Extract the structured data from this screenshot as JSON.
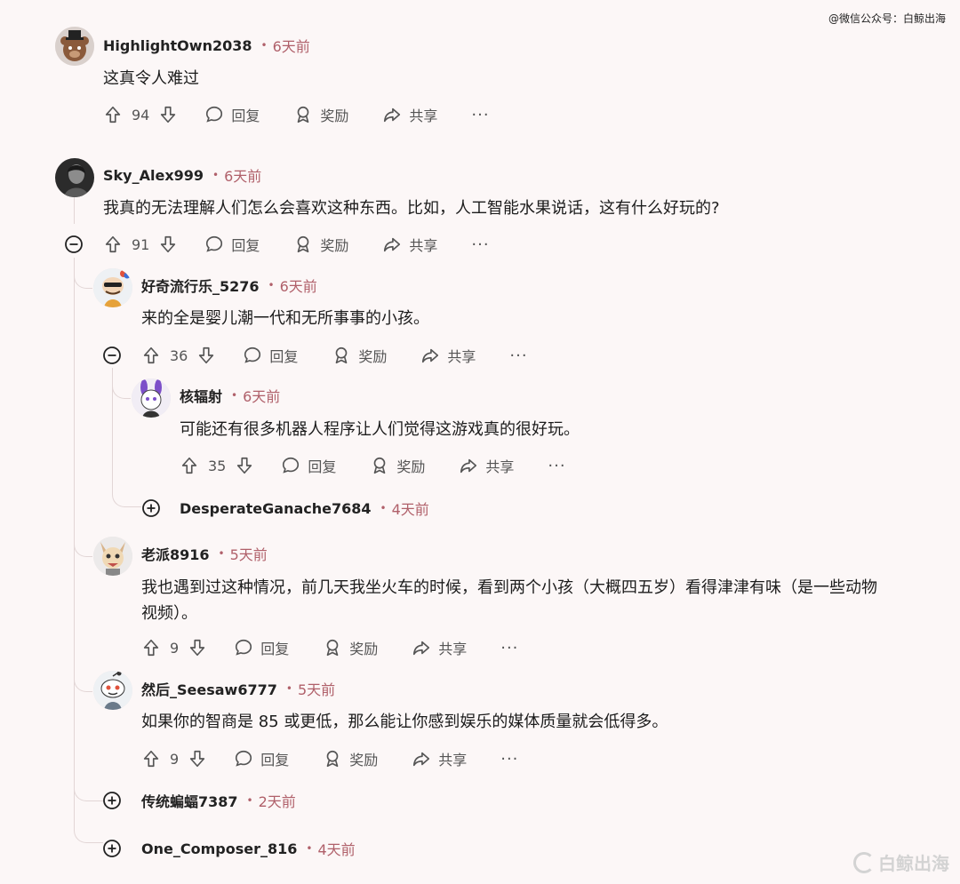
{
  "watermark": {
    "top": "@微信公众号：白鲸出海",
    "bottom": "白鲸出海"
  },
  "actions": {
    "reply": "回复",
    "award": "奖励",
    "share": "共享",
    "more": "···"
  },
  "comments": [
    {
      "username": "HighlightOwn2038",
      "dot": "•",
      "time": "6天前",
      "text": "这真令人难过",
      "votes": "94"
    },
    {
      "username": "Sky_Alex999",
      "dot": "•",
      "time": "6天前",
      "text": "我真的无法理解人们怎么会喜欢这种东西。比如，人工智能水果说话，这有什么好玩的?",
      "votes": "91"
    },
    {
      "username": "好奇流行乐_5276",
      "dot": "•",
      "time": "6天前",
      "text": "来的全是婴儿潮一代和无所事事的小孩。",
      "votes": "36"
    },
    {
      "username": "核辐射",
      "dot": "•",
      "time": "6天前",
      "text": "可能还有很多机器人程序让人们觉得这游戏真的很好玩。",
      "votes": "35"
    },
    {
      "username": "DesperateGanache7684",
      "dot": "•",
      "time": "4天前"
    },
    {
      "username": "老派8916",
      "dot": "•",
      "time": "5天前",
      "text_line1": "我也遇到过这种情况，前几天我坐火车的时候，看到两个小孩（大概四五岁）看得津津有味（是一些动物",
      "text_line2": "视频）。",
      "votes": "9"
    },
    {
      "username": "然后_Seesaw6777",
      "dot": "•",
      "time": "5天前",
      "text": "如果你的智商是 85 或更低，那么能让你感到娱乐的媒体质量就会低得多。",
      "votes": "9"
    },
    {
      "username": "传统蝙蝠7387",
      "dot": "•",
      "time": "2天前"
    },
    {
      "username": "One_Composer_816",
      "dot": "•",
      "time": "4天前"
    }
  ]
}
